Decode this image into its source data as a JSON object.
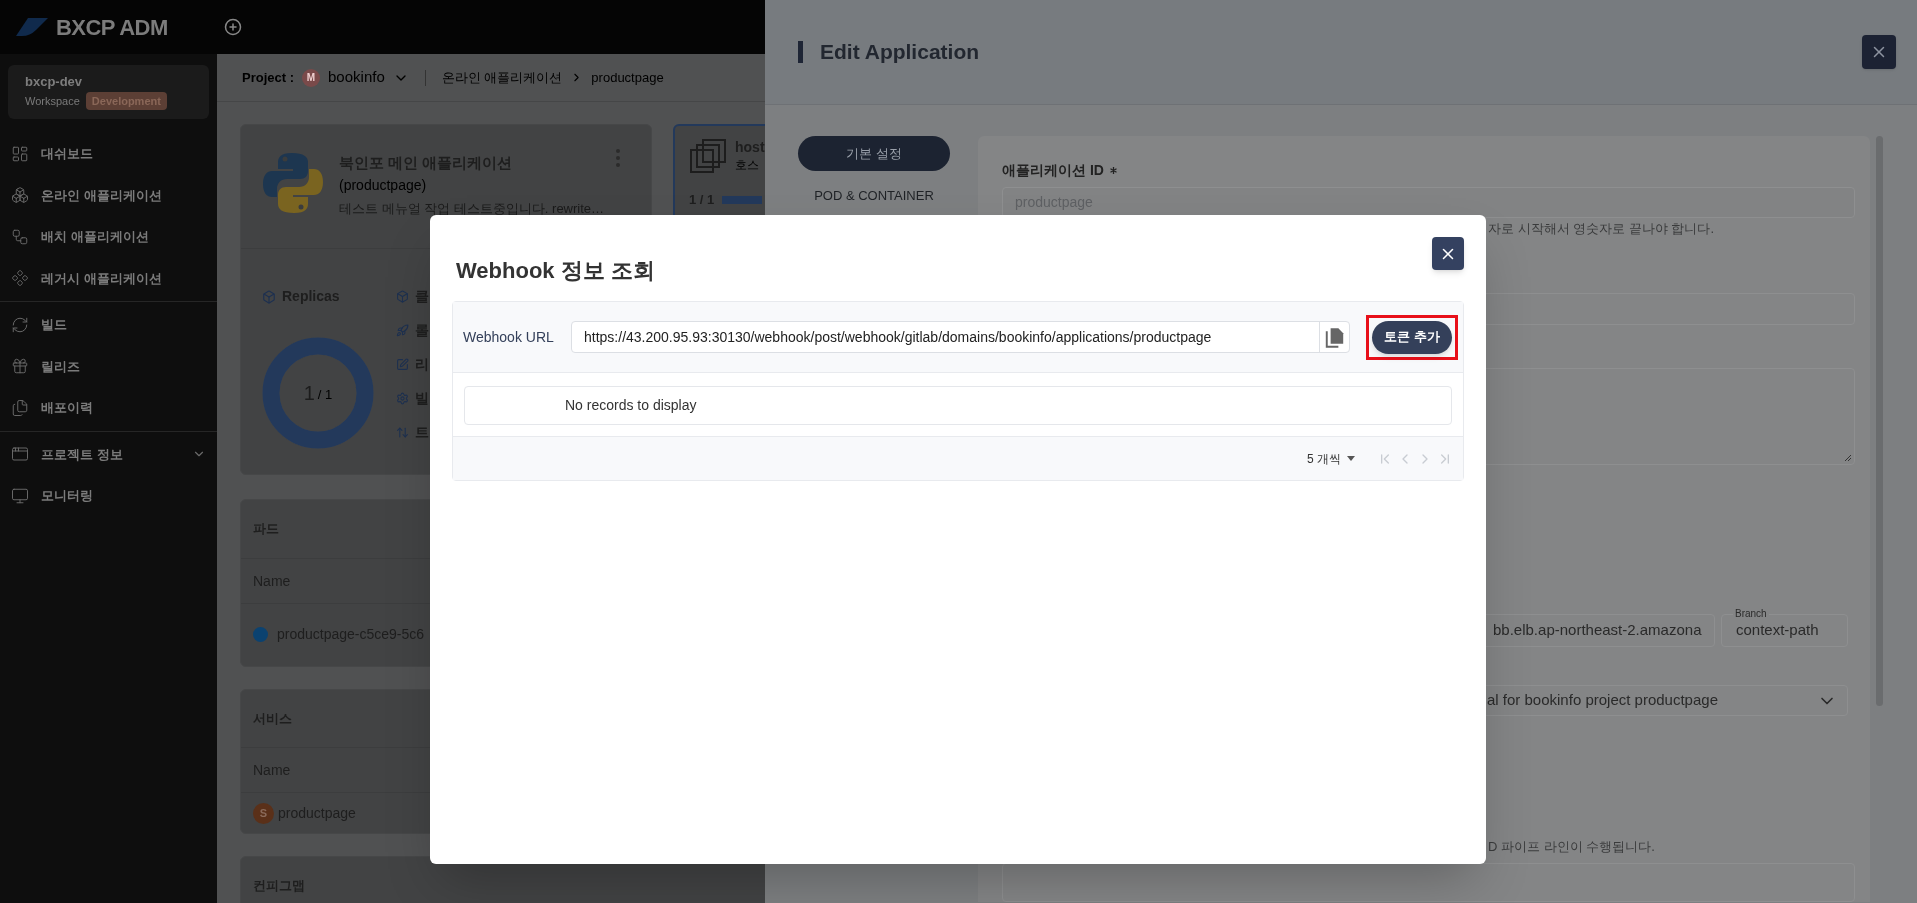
{
  "topbar": {
    "brand": "BXCP ADM"
  },
  "workspace": {
    "name": "bxcp-dev",
    "label": "Workspace",
    "env": "Development"
  },
  "sidebar": {
    "sections": [
      {
        "items": [
          {
            "label": "대쉬보드",
            "kind": "link"
          },
          {
            "label": "온라인 애플리케이션",
            "kind": "link"
          },
          {
            "label": "배치 애플리케이션",
            "kind": "link"
          },
          {
            "label": "레거시 애플리케이션",
            "kind": "link"
          }
        ]
      },
      {
        "items": [
          {
            "label": "빌드",
            "kind": "link"
          },
          {
            "label": "릴리즈",
            "kind": "link"
          },
          {
            "label": "배포이력",
            "kind": "link"
          }
        ]
      },
      {
        "items": [
          {
            "label": "프로젝트 정보",
            "kind": "group"
          },
          {
            "label": "모니터링",
            "kind": "link"
          }
        ]
      }
    ]
  },
  "breadcrumb": {
    "label": "Project :",
    "avatar": "M",
    "project": "bookinfo",
    "path": [
      "온라인 애플리케이션",
      "productpage"
    ]
  },
  "app_card": {
    "title": "북인포 메인 애플리케이션",
    "subtitle": "(productpage)",
    "description": "테스트 메뉴얼 작업 테스트중입니다. rewrite…",
    "replicas": {
      "label": "Replicas",
      "current": "1",
      "separator": "/",
      "total": "1",
      "level": 1
    },
    "details": [
      "클",
      "롤",
      "리",
      "빌",
      "트"
    ]
  },
  "host_card": {
    "title": "host",
    "subtitle": "호스",
    "current": "1",
    "separator": "/",
    "total": "1",
    "level": 1
  },
  "pods": {
    "title": "파드",
    "column": "Name",
    "rows": [
      {
        "name": "productpage-c5ce9-5c6",
        "color": "#0b4270"
      }
    ]
  },
  "services": {
    "title": "서비스",
    "column": "Name",
    "rows": [
      {
        "badge": "S",
        "name": "productpage"
      }
    ]
  },
  "configmaps": {
    "title": "컨피그맵"
  },
  "drawer": {
    "title": "Edit Application",
    "nav": [
      {
        "label": "기본 설정",
        "selected": true
      },
      {
        "label": "POD & CONTAINER",
        "selected": false
      }
    ],
    "id_field": {
      "label": "애플리케이션 ID",
      "required": true,
      "value": "productpage",
      "disabled": true,
      "help": "자로 시작해서 영숫자로 끝나야 합니다."
    },
    "repo_url": "bb.elb.ap-northeast-2.amazona",
    "branch": {
      "label": "Branch",
      "value": "context-path"
    },
    "pipeline": {
      "value": "al for bookinfo project productpage",
      "help": "D 파이프 라인이 수행됩니다."
    }
  },
  "modal": {
    "title": "Webhook 정보 조회",
    "url_label": "Webhook URL",
    "url": "https://43.200.95.93:30130/webhook/post/webhook/gitlab/domains/bookinfo/applications/productpage",
    "add_button": "토큰 추가",
    "highlighted": true,
    "empty": "No records to display",
    "page_size": "5 개씩",
    "pagination_disabled": true
  }
}
